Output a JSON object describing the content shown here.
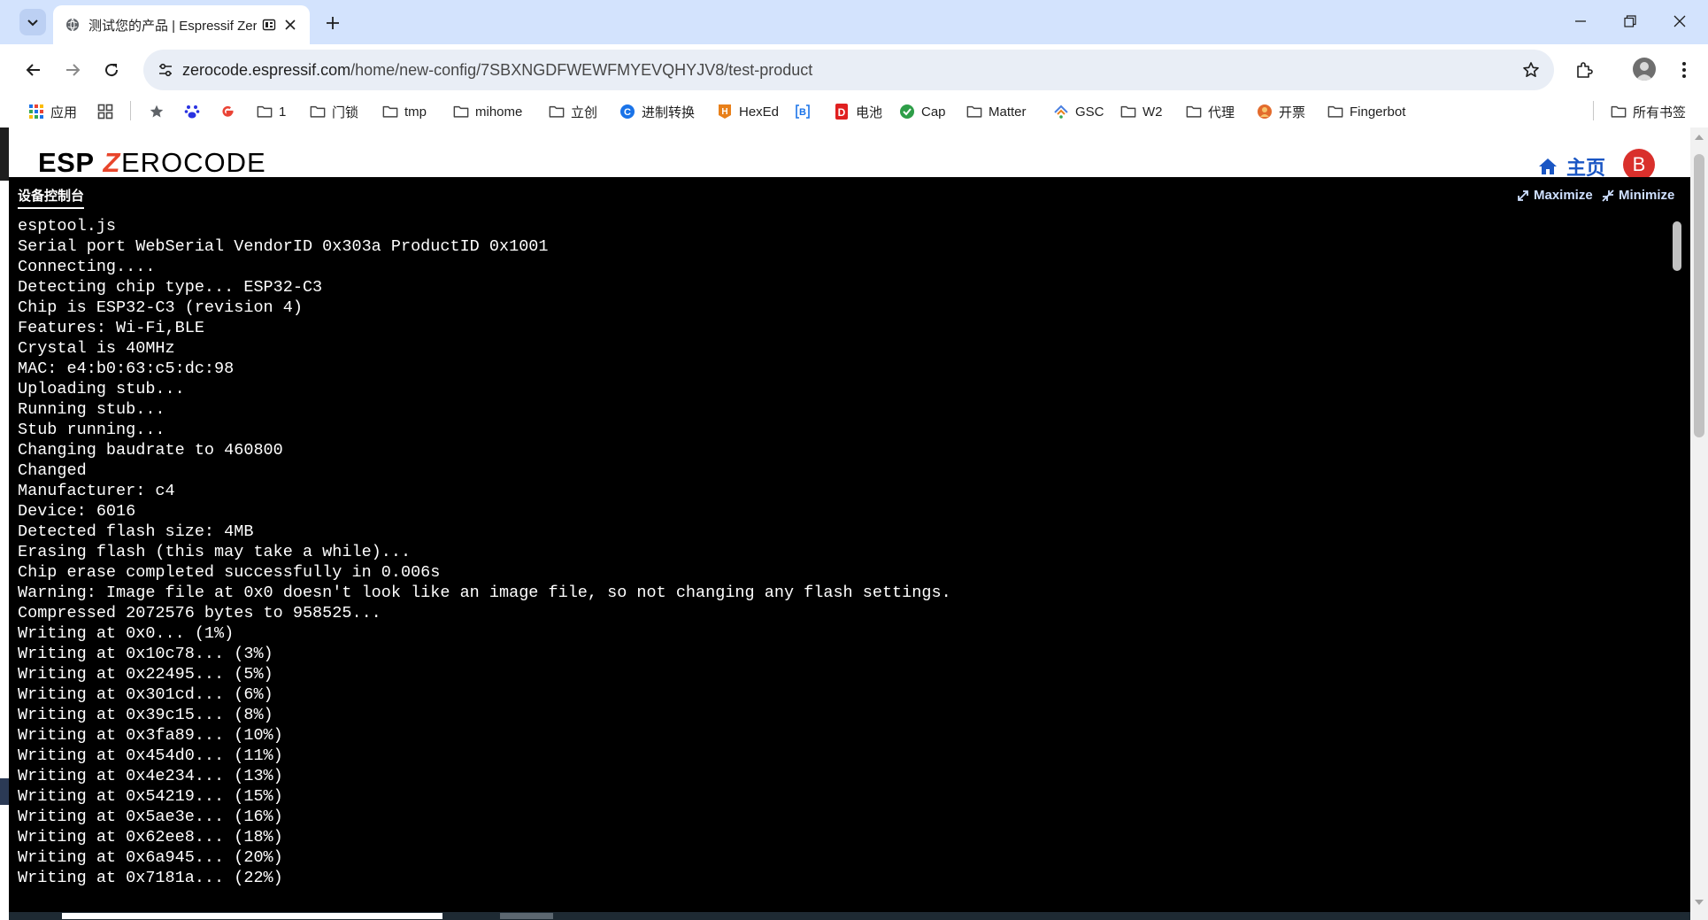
{
  "browser": {
    "tab": {
      "title": "测试您的产品 | Espressif Zer"
    },
    "address": {
      "host": "zerocode.espressif.com",
      "path": "/home/new-config/7SBXNGDFWEWFMYEVQHYJV8/test-product"
    },
    "icons": {
      "tab_search": "chevron-down-icon",
      "favicon": "globe-icon",
      "audio": "speaker-icon",
      "close": "close-icon",
      "new_tab": "plus-icon",
      "back": "back-arrow-icon",
      "forward": "forward-arrow-icon",
      "reload": "reload-icon",
      "site_info": "tune-icon",
      "bookmark": "star-icon",
      "extensions": "puzzle-icon",
      "menu": "kebab-icon"
    }
  },
  "bookmarks": {
    "items": [
      {
        "label": "应用",
        "icon": "apps-grid-icon"
      },
      {
        "label": "",
        "icon": "layout-grid-icon"
      },
      {
        "label": "",
        "icon": "star-icon"
      },
      {
        "label": "",
        "icon": "baidu-paw-icon"
      },
      {
        "label": "",
        "icon": "google-icon"
      },
      {
        "label": "1",
        "icon": "folder-icon"
      },
      {
        "label": "门锁",
        "icon": "folder-icon"
      },
      {
        "label": "tmp",
        "icon": "folder-icon"
      },
      {
        "label": "mihome",
        "icon": "folder-icon"
      },
      {
        "label": "立创",
        "icon": "folder-icon"
      },
      {
        "label": "进制转换",
        "icon": "converter-icon"
      },
      {
        "label": "HexEd",
        "icon": "hexed-icon"
      },
      {
        "label": "",
        "icon": "bracket-b-icon"
      },
      {
        "label": "电池",
        "icon": "battery-site-icon"
      },
      {
        "label": "Cap",
        "icon": "cap-icon"
      },
      {
        "label": "Matter",
        "icon": "folder-icon"
      },
      {
        "label": "GSC",
        "icon": "gsc-icon"
      },
      {
        "label": "W2",
        "icon": "folder-icon"
      },
      {
        "label": "代理",
        "icon": "folder-icon"
      },
      {
        "label": "开票",
        "icon": "invoice-icon"
      },
      {
        "label": "Fingerbot",
        "icon": "folder-icon"
      }
    ],
    "other": {
      "label": "所有书签",
      "icon": "folder-icon"
    }
  },
  "header": {
    "logo": {
      "brand": "ESP",
      "z": "Z",
      "rest": "EROCODE"
    },
    "home_label": "主页",
    "avatar_letter": "B",
    "colors": {
      "accent": "#1a56c4",
      "logo_z": "#e8452b",
      "avatar": "#d9302c"
    }
  },
  "console": {
    "title": "设备控制台",
    "maximize_label": "Maximize",
    "minimize_label": "Minimize",
    "lines": [
      "esptool.js",
      "Serial port WebSerial VendorID 0x303a ProductID 0x1001",
      "Connecting....",
      "Detecting chip type... ESP32-C3",
      "Chip is ESP32-C3 (revision 4)",
      "Features: Wi-Fi,BLE",
      "Crystal is 40MHz",
      "MAC: e4:b0:63:c5:dc:98",
      "Uploading stub...",
      "Running stub...",
      "Stub running...",
      "Changing baudrate to 460800",
      "Changed",
      "Manufacturer: c4",
      "Device: 6016",
      "Detected flash size: 4MB",
      "Erasing flash (this may take a while)...",
      "Chip erase completed successfully in 0.006s",
      "Warning: Image file at 0x0 doesn't look like an image file, so not changing any flash settings.",
      "Compressed 2072576 bytes to 958525...",
      "Writing at 0x0... (1%)",
      "Writing at 0x10c78... (3%)",
      "Writing at 0x22495... (5%)",
      "Writing at 0x301cd... (6%)",
      "Writing at 0x39c15... (8%)",
      "Writing at 0x3fa89... (10%)",
      "Writing at 0x454d0... (11%)",
      "Writing at 0x4e234... (13%)",
      "Writing at 0x54219... (15%)",
      "Writing at 0x5ae3e... (16%)",
      "Writing at 0x62ee8... (18%)",
      "Writing at 0x6a945... (20%)",
      "Writing at 0x7181a... (22%)"
    ]
  }
}
